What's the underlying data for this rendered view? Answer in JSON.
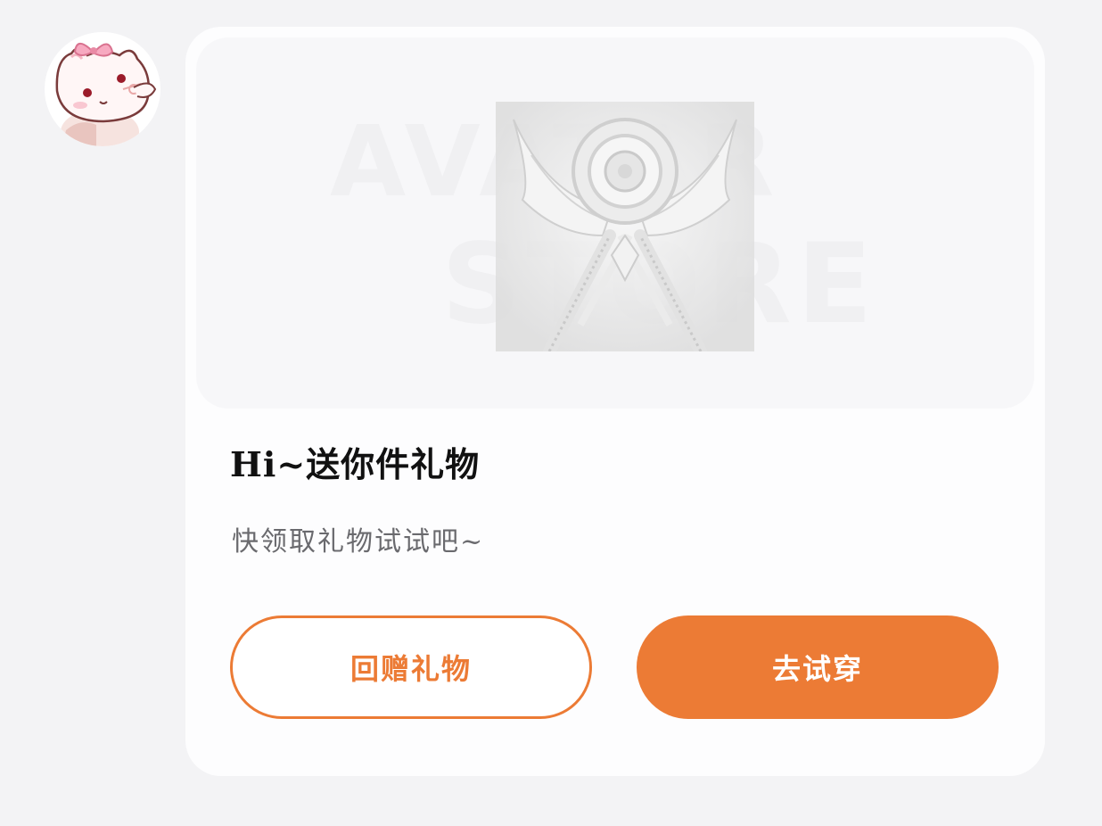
{
  "sender": {
    "avatar_icon": "kitten-avatar-icon"
  },
  "gift_card": {
    "banner": {
      "watermark_line1": "AVATAR",
      "watermark_line2": "STORE",
      "emblem_icon": "winged-emblem-icon"
    },
    "title": "Hi~送你件礼物",
    "subtitle": "快领取礼物试试吧~",
    "buttons": {
      "return_gift_label": "回赠礼物",
      "try_on_label": "去试穿"
    }
  },
  "colors": {
    "accent": "#ec7b35",
    "background": "#f3f3f5",
    "card": "#fdfdfe",
    "title_text": "#111111",
    "subtitle_text": "#6a6a6e"
  }
}
